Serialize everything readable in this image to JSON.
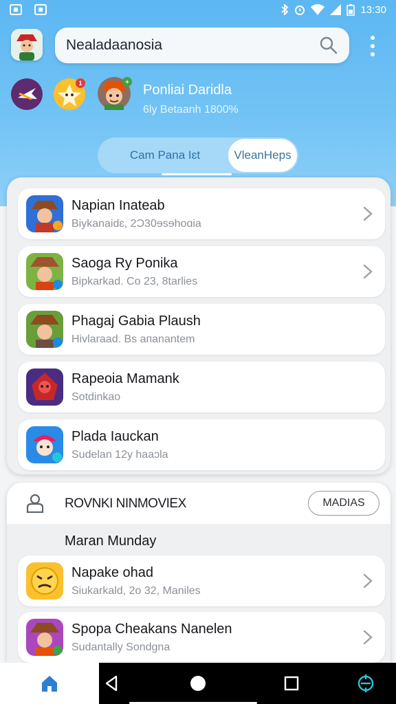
{
  "status_bar": {
    "time": "13:30"
  },
  "search": {
    "value": "Nealadaanosia"
  },
  "profile": {
    "name": "Ponliai Daridla",
    "subtitle": "6ly Betaanh 1800%"
  },
  "tabs": {
    "left": "Cam Pana Iɛt",
    "right": "VleanHeps"
  },
  "list1": [
    {
      "title": "Napian Inateab",
      "subtitle": "Biykanaidɛ, 2Ɔ30ɘsɘhoɑia"
    },
    {
      "title": "Saoga Ry Ponika",
      "subtitle": "Bipkarkad. Co 23, 8tarlies"
    },
    {
      "title": "Phagaj Gabia Plaush",
      "subtitle": "Hivlaraad. Bs aпanantem"
    },
    {
      "title": "Rapeoia Mamank",
      "subtitle": "Sotdinkao"
    },
    {
      "title": "Plada Iauckan",
      "subtitle": "Sudelan 12y haaɔla"
    }
  ],
  "section2": {
    "title": "ROVNKI NINMOVIEX",
    "button": "MADIAS",
    "label": "Maran Munday",
    "items": [
      {
        "title": "Napake ohad",
        "subtitle": "Siukarkald, 2o 32, Maniles"
      },
      {
        "title": "Spopa Cheakans Nanelen",
        "subtitle": "Sudantally Sondgna"
      }
    ]
  },
  "colors": {
    "accent": "#5cb7f2",
    "active_tab": "#2c7fd1",
    "notification": "#e53935"
  }
}
